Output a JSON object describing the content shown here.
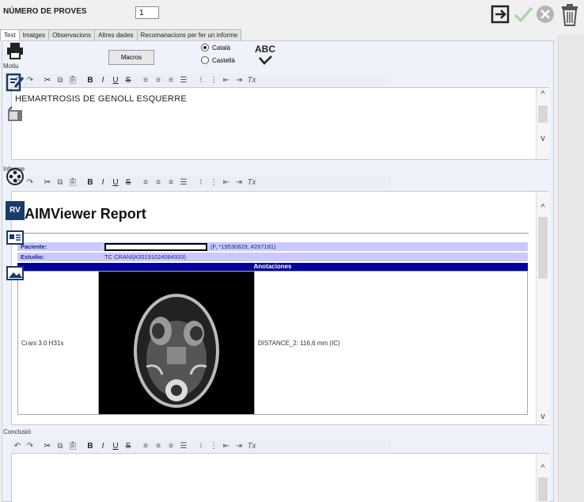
{
  "header": {
    "num_proves_label": "NÚMERO DE PROVES",
    "num_proves_value": "1"
  },
  "tabs": [
    {
      "label": "Text",
      "active": true
    },
    {
      "label": "Imatges",
      "active": false
    },
    {
      "label": "Observacions",
      "active": false
    },
    {
      "label": "Altres dades",
      "active": false
    },
    {
      "label": "Recomanacions per fer un informe",
      "active": false
    }
  ],
  "motiu": {
    "label": "Motiu",
    "macros_button": "Macros",
    "language_options": [
      "Català",
      "Castellà"
    ],
    "language_selected": "Català",
    "spellcheck_label": "ABC",
    "text": "HEMARTROSIS DE GENOLL ESQUERRE"
  },
  "informe": {
    "label": "Informe",
    "report_title": "RAIMViewer Report",
    "paciente_label": "Paciente:",
    "paciente_value": "(F, *19530829, #267181)",
    "estudio_label": "Estudio:",
    "estudio_value": "TC CRANI(#20191024084933)",
    "anotaciones_header": "Anotaciones",
    "series_label": "Crani 3.0 H31s",
    "measurement": "DISTANCE_2: 116,6 mm (IC)"
  },
  "conclusio": {
    "label": "Conclusió"
  },
  "toolbar_icons": [
    "undo-icon",
    "redo-icon",
    "cut-icon",
    "copy-icon",
    "paste-icon",
    "bold-icon",
    "italic-icon",
    "underline-icon",
    "strikethrough-icon",
    "align-left-icon",
    "align-center-icon",
    "align-right-icon",
    "align-justify-icon",
    "bullet-list-icon",
    "numbered-list-icon",
    "outdent-icon",
    "indent-icon",
    "clear-format-icon"
  ],
  "sidebar": {
    "rv_label": "RV"
  },
  "colors": {
    "table_row": "#c9c9ff",
    "table_header": "#0000a0",
    "check_green": "#a8d8a8",
    "cancel_grey": "#b5b5b5"
  }
}
